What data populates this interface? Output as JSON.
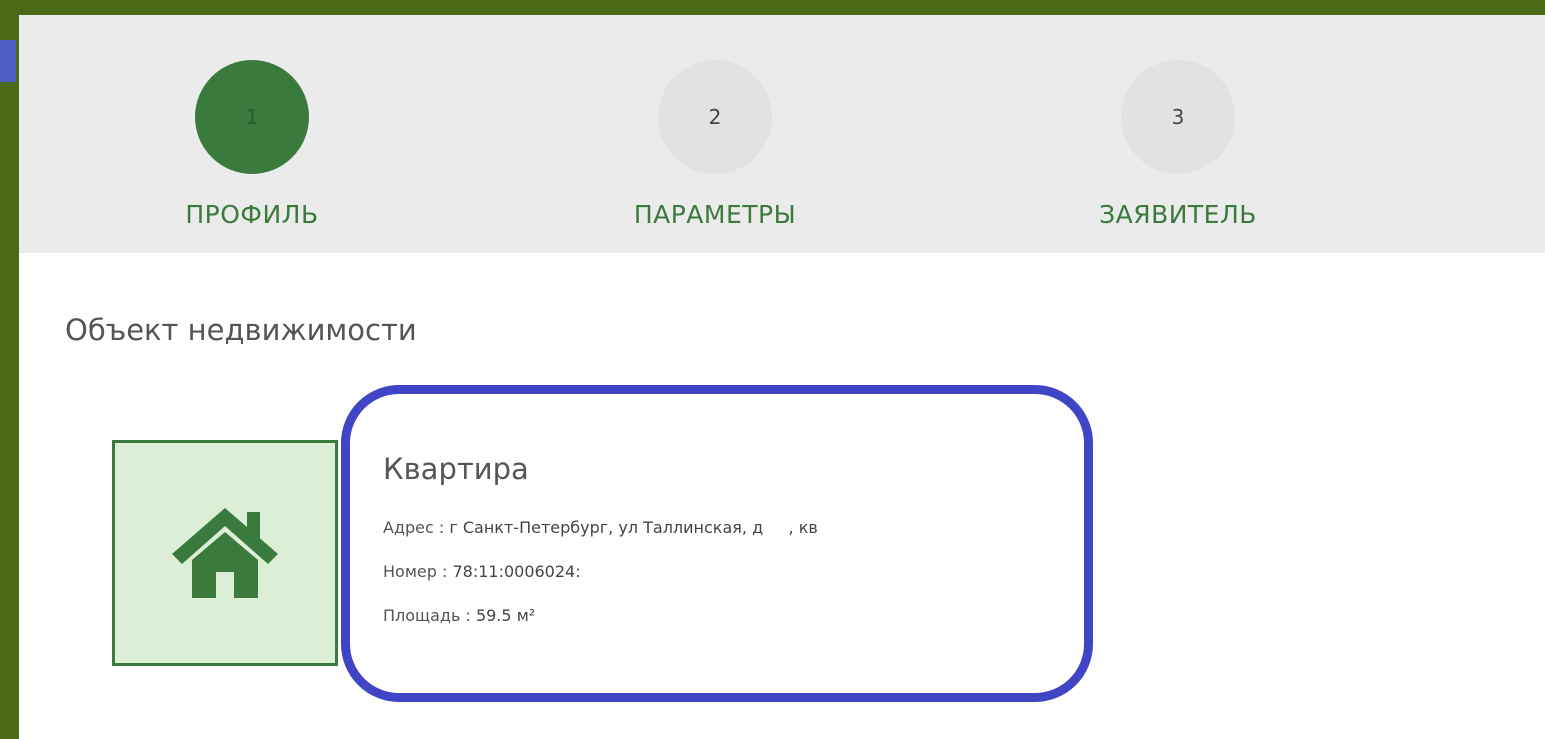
{
  "steps": [
    {
      "number": "1",
      "label": "ПРОФИЛЬ",
      "active": true
    },
    {
      "number": "2",
      "label": "ПАРАМЕТРЫ",
      "active": false
    },
    {
      "number": "3",
      "label": "ЗАЯВИТЕЛЬ",
      "active": false
    }
  ],
  "section": {
    "title": "Объект недвижимости"
  },
  "property": {
    "icon": "house-icon",
    "type": "Квартира",
    "address_label": "Адрес : ",
    "address_value": "г Санкт-Петербург, ул Таллинская, д     , кв",
    "number_label": "Номер : ",
    "number_value": "78:11:0006024:",
    "area_label": "Площадь : ",
    "area_value": "59.5 м²"
  },
  "colors": {
    "accent_green": "#3a7a3d",
    "highlight_blue": "#3f45c4",
    "frame_green": "#4b6a17"
  }
}
